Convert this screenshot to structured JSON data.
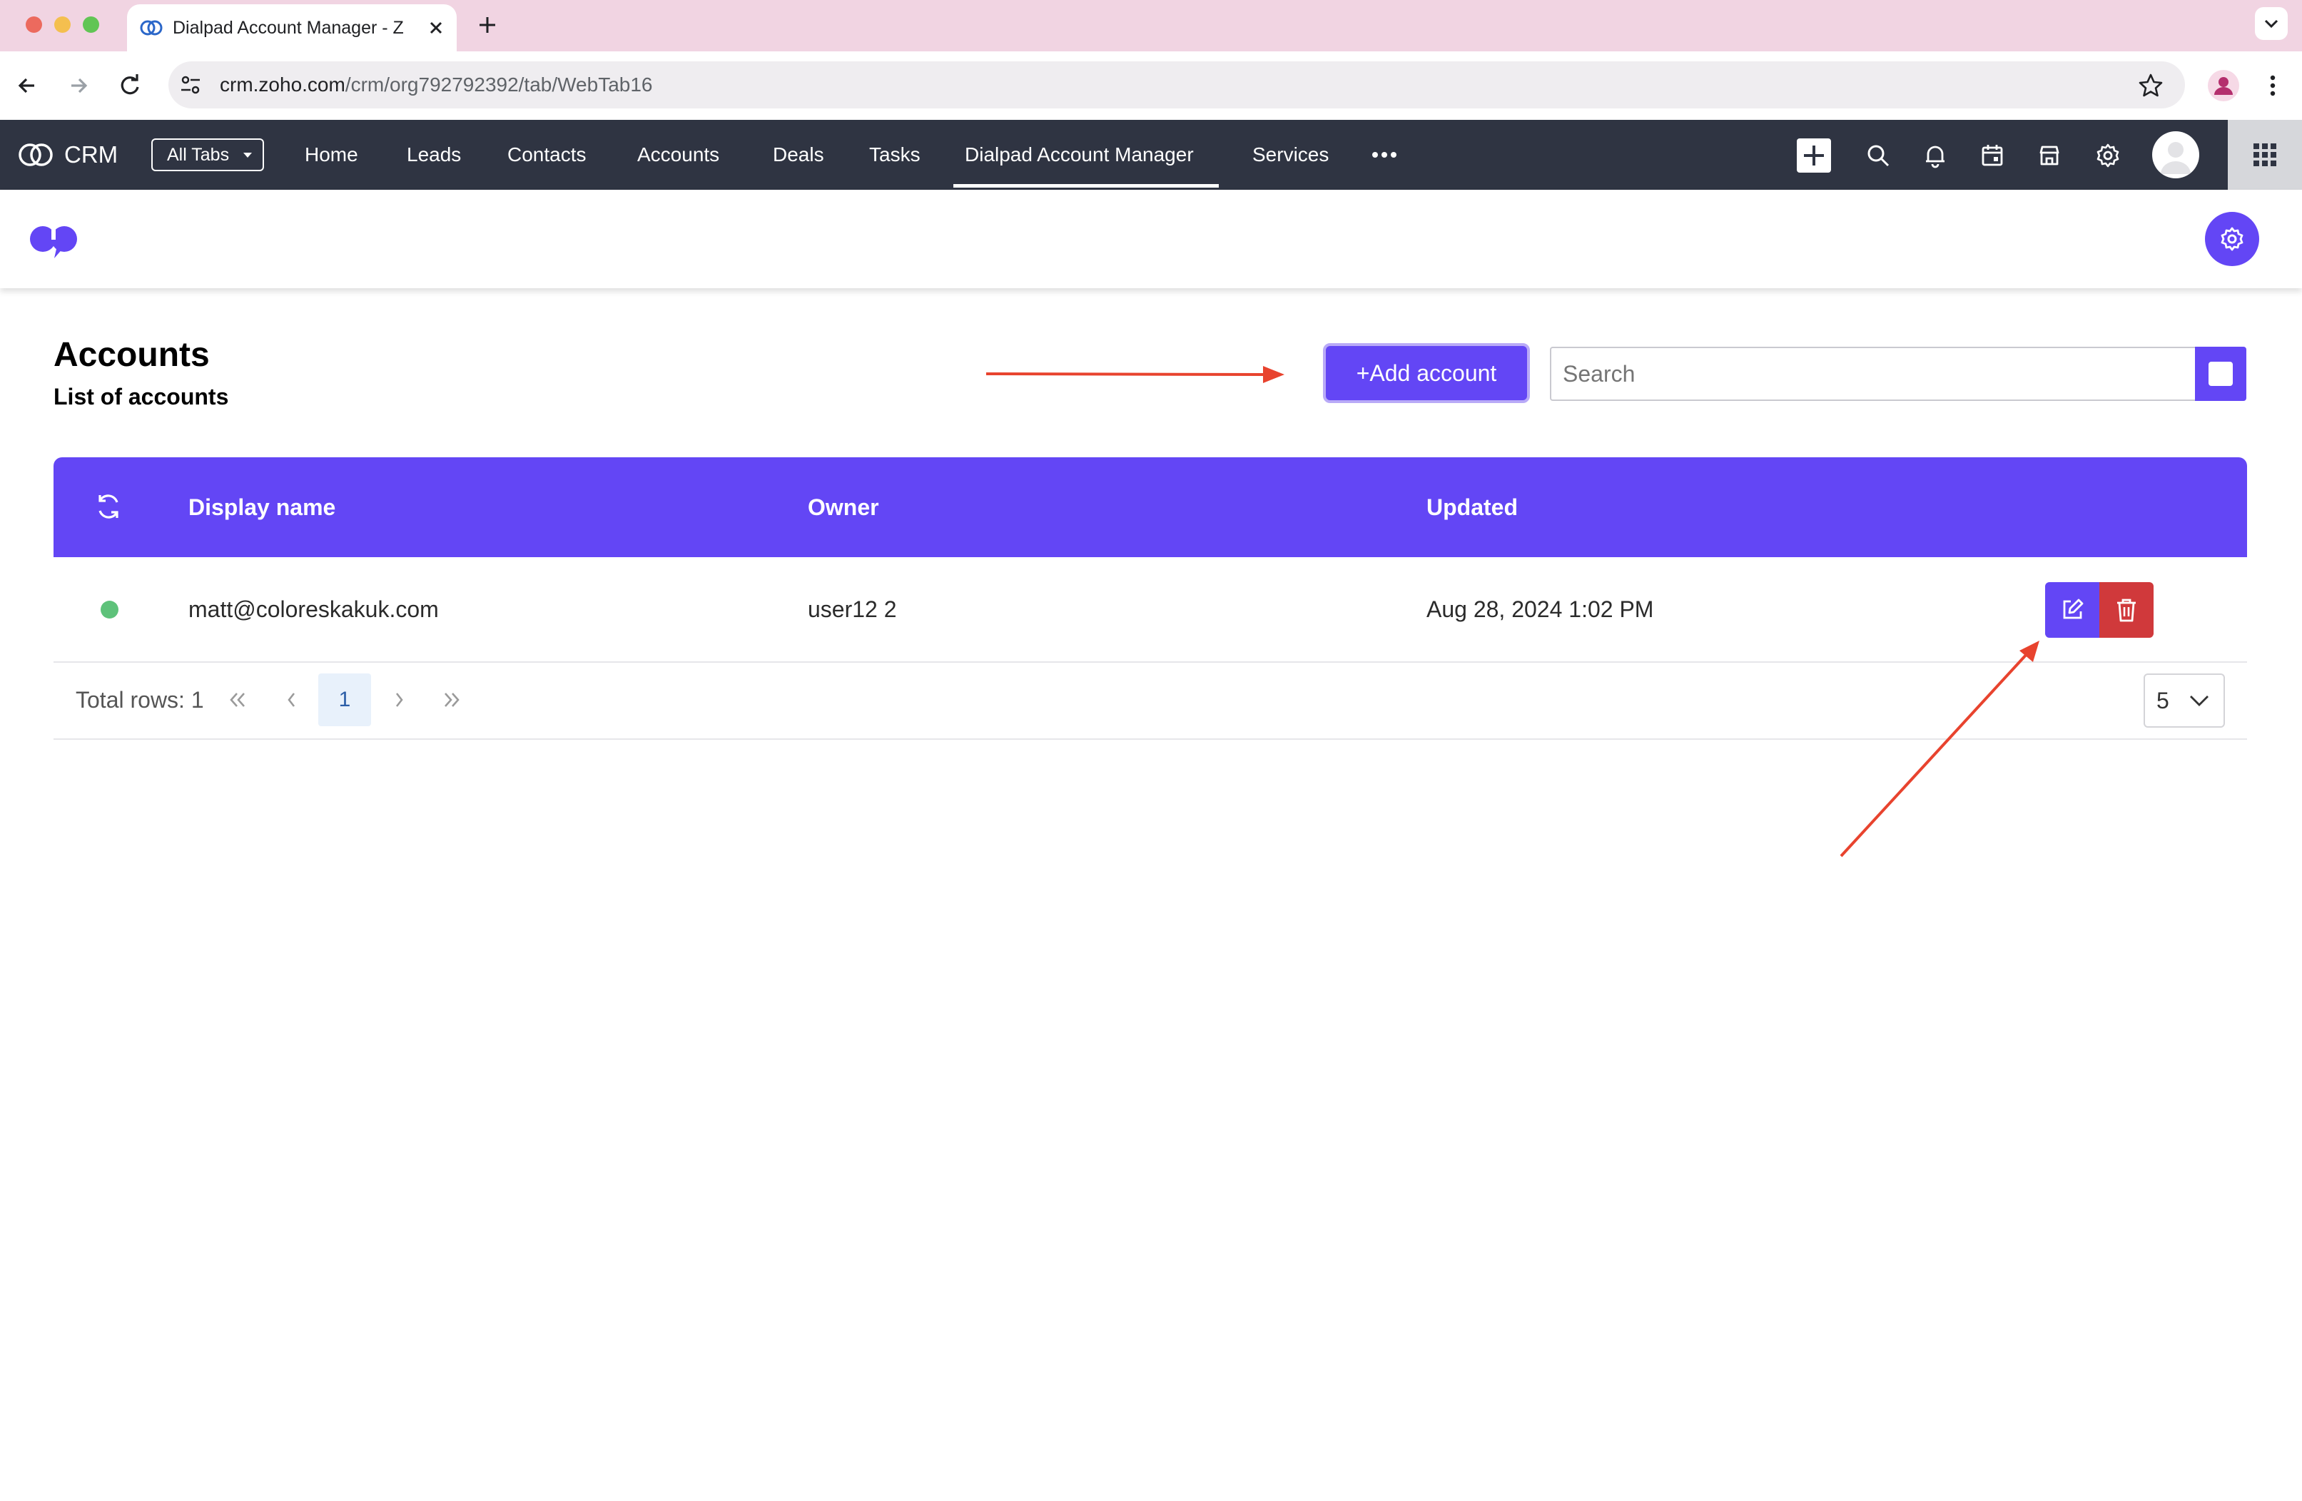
{
  "browser": {
    "tab_title": "Dialpad Account Manager - Z",
    "url_domain": "crm.zoho.com",
    "url_path": "/crm/org792792392/tab/WebTab16"
  },
  "crm_nav": {
    "brand": "CRM",
    "all_tabs_label": "All Tabs",
    "items": [
      "Home",
      "Leads",
      "Contacts",
      "Accounts",
      "Deals",
      "Tasks",
      "Dialpad Account Manager",
      "Services"
    ],
    "active_item": "Dialpad Account Manager"
  },
  "page": {
    "title": "Accounts",
    "subtitle": "List of accounts",
    "add_button_label": "+Add account",
    "search_placeholder": "Search"
  },
  "table": {
    "columns": [
      "Display name",
      "Owner",
      "Updated"
    ],
    "rows": [
      {
        "status": "active",
        "display_name": "matt@coloreskakuk.com",
        "owner": "user12 2",
        "updated": "Aug 28, 2024 1:02 PM"
      }
    ]
  },
  "pagination": {
    "total_rows_label": "Total rows: 1",
    "current_page": "1",
    "page_size": "5"
  },
  "colors": {
    "accent": "#6346f5",
    "danger": "#d0393b",
    "nav_bg": "#2f3442",
    "status_active": "#5ec27a",
    "annotation_arrow": "#e8432e"
  }
}
